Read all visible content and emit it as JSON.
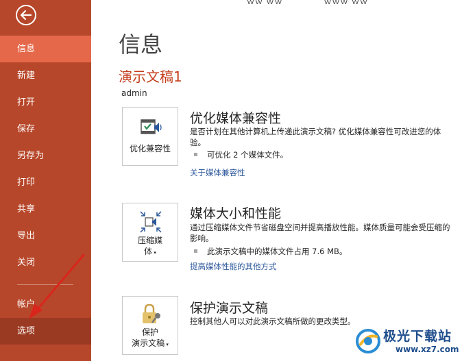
{
  "sidebar": {
    "items": [
      {
        "label": "信息",
        "active": true
      },
      {
        "label": "新建"
      },
      {
        "label": "打开"
      },
      {
        "label": "保存"
      },
      {
        "label": "另存为"
      },
      {
        "label": "打印"
      },
      {
        "label": "共享"
      },
      {
        "label": "导出"
      },
      {
        "label": "关闭"
      },
      {
        "label": "帐户"
      },
      {
        "label": "选项"
      }
    ],
    "back_icon": "back-arrow-icon"
  },
  "top_strip": "ｗｗ ｗｗ　　　　　ｗｗｗ ｗｗ",
  "main": {
    "title": "信息",
    "doc_name": "演示文稿1",
    "author": "admin",
    "sections": [
      {
        "button_label": "优化兼容性",
        "icon": "media-compatibility-icon",
        "title": "优化媒体兼容性",
        "desc": "是否计划在其他计算机上传递此演示文稿? 优化媒体兼容性可改进您的体验。",
        "bullet": "可优化 2 个媒体文件。",
        "link": "关于媒体兼容性"
      },
      {
        "button_label_1": "压缩媒",
        "button_label_2": "体",
        "icon": "compress-media-icon",
        "title": "媒体大小和性能",
        "desc": "通过压缩媒体文件节省磁盘空间并提高播放性能。媒体质量可能会受压缩的影响。",
        "bullet": "此演示文稿中的媒体文件占用 7.6 MB。",
        "link": "提高媒体性能的其他方式"
      },
      {
        "button_label_1": "保护",
        "button_label_2": "演示文稿",
        "icon": "lock-key-icon",
        "title": "保护演示文稿",
        "desc": "控制其他人可以对此演示文稿所做的更改类型。"
      }
    ]
  },
  "watermark": {
    "name": "极光下载站",
    "url": "www.xz7.com"
  },
  "colors": {
    "sidebar": "#b7472a",
    "active": "#e5684a",
    "accent_text": "#c43e1c",
    "link": "#2b579a",
    "arrow": "#d9261c"
  }
}
